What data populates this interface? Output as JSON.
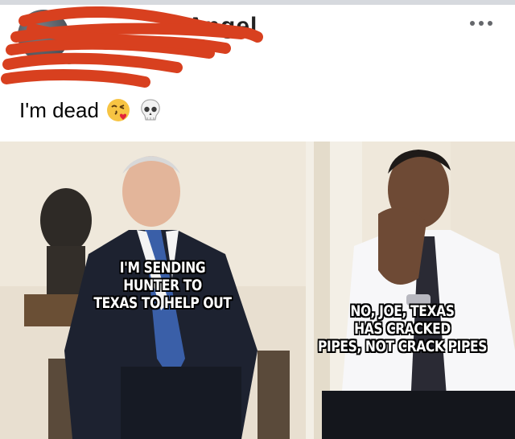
{
  "post": {
    "author_name": "Angel",
    "text": "I'm dead",
    "emojis": [
      "face-blowing-kiss-icon",
      "skull-icon"
    ]
  },
  "meme": {
    "left_caption": [
      "I'M SENDING",
      "HUNTER TO",
      "TEXAS TO HELP OUT"
    ],
    "right_caption": [
      "NO, JOE, TEXAS",
      "HAS CRACKED",
      "PIPES, NOT CRACK PIPES"
    ]
  },
  "colors": {
    "redaction": "#d8401f",
    "online_status": "#31a24c",
    "menu_dots": "#65676b"
  },
  "icons": [
    "more-options-icon",
    "face-blowing-kiss-icon",
    "skull-icon"
  ]
}
